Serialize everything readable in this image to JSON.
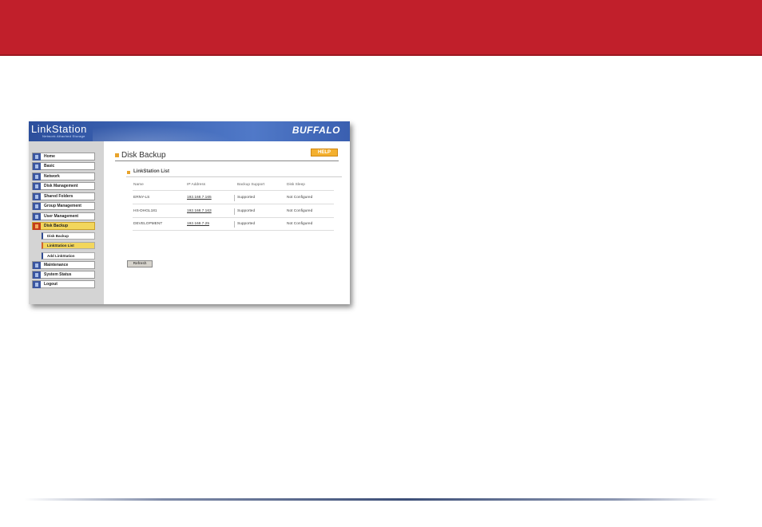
{
  "window": {
    "app_name": "LinkStation",
    "app_subtitle": "Network Attached Storage",
    "vendor_logo": "BUFFALO"
  },
  "sidebar": {
    "items": [
      {
        "label": "Home",
        "icon": "home-icon"
      },
      {
        "label": "Basic",
        "icon": "basic-icon"
      },
      {
        "label": "Network",
        "icon": "network-icon"
      },
      {
        "label": "Disk Management",
        "icon": "disk-icon"
      },
      {
        "label": "Shared Folders",
        "icon": "folder-icon"
      },
      {
        "label": "Group Management",
        "icon": "group-icon"
      },
      {
        "label": "User Management",
        "icon": "user-icon"
      },
      {
        "label": "Disk Backup",
        "icon": "backup-icon",
        "active": true
      },
      {
        "label": "Maintenance",
        "icon": "maintenance-icon"
      },
      {
        "label": "System Status",
        "icon": "status-icon"
      },
      {
        "label": "Logout",
        "icon": "logout-icon"
      }
    ],
    "sub_items": [
      {
        "label": "Disk Backup"
      },
      {
        "label": "LinkStation List",
        "active": true
      },
      {
        "label": "Add LinkStation"
      }
    ]
  },
  "main": {
    "title": "Disk Backup",
    "help_label": "HELP",
    "section_title": "LinkStation List",
    "table": {
      "headers": [
        "Name",
        "IP Address",
        "Backup Support",
        "Disk Sleep"
      ],
      "rows": [
        [
          "ERNY-LS",
          "192.168.7.165",
          "Supported",
          "Not Configured"
        ],
        [
          "HS-DHGL181",
          "192.168.7.163",
          "Supported",
          "Not Configured"
        ],
        [
          "DEVELOPMENT",
          "192.168.7.25",
          "Supported",
          "Not Configured"
        ]
      ]
    },
    "refresh_label": "Refresh"
  },
  "colors": {
    "top_band": "#c11f2b",
    "header_blue": "#3c63b3",
    "active_nav": "#f2d65c",
    "help_button": "#f4b02f"
  }
}
